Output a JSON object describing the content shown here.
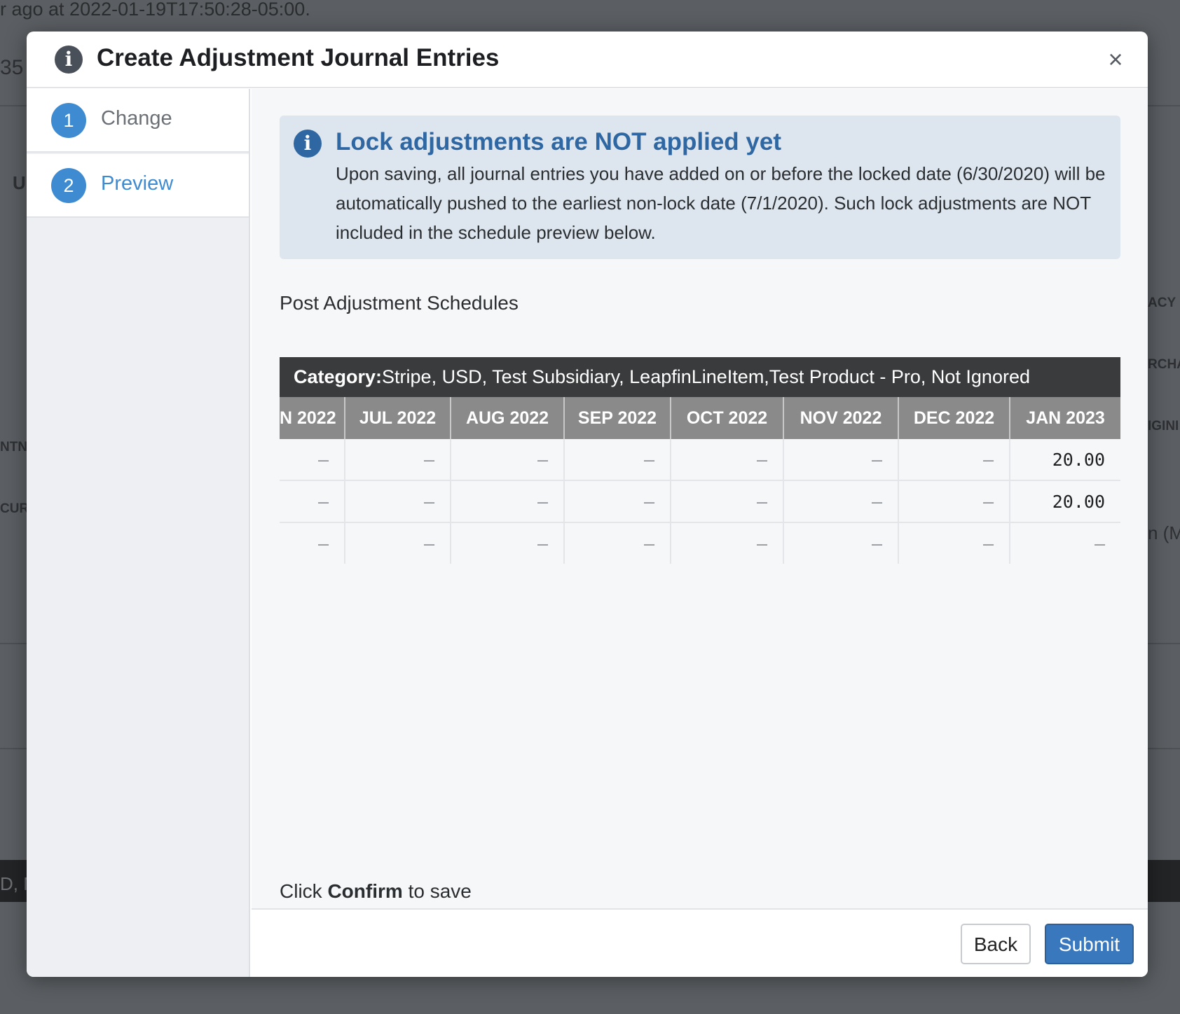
{
  "background": {
    "top_text": "r ago at 2022-01-19T17:50:28-05:00.",
    "number_fragment": "35",
    "left_fragments": [
      "U",
      "NTN",
      "CURR",
      "D, M"
    ],
    "right_fragments": [
      "ACY",
      "RCHA",
      "IGINI",
      "n (M"
    ]
  },
  "modal": {
    "title": "Create Adjustment Journal Entries",
    "info_icon": "i",
    "close_label": "×"
  },
  "steps": [
    {
      "number": "1",
      "label": "Change",
      "active": false
    },
    {
      "number": "2",
      "label": "Preview",
      "active": true
    }
  ],
  "alert": {
    "icon": "i",
    "title": "Lock adjustments are NOT applied yet",
    "body": "Upon saving, all journal entries you have added on or before the locked date (6/30/2020) will be automatically pushed to the earliest non-lock date (7/1/2020). Such lock adjustments are NOT included in the schedule preview below."
  },
  "schedules": {
    "label": "Post Adjustment Schedules",
    "category_prefix": "Category:",
    "category_value": "Stripe, USD, Test Subsidiary, LeapfinLineItem,Test Product - Pro, Not Ignored",
    "columns": [
      "N 2022",
      "JUL 2022",
      "AUG 2022",
      "SEP 2022",
      "OCT 2022",
      "NOV 2022",
      "DEC 2022",
      "JAN 2023"
    ],
    "rows": [
      [
        "–",
        "–",
        "–",
        "–",
        "–",
        "–",
        "–",
        "20.00"
      ],
      [
        "–",
        "–",
        "–",
        "–",
        "–",
        "–",
        "–",
        "20.00"
      ],
      [
        "–",
        "–",
        "–",
        "–",
        "–",
        "–",
        "–",
        "–"
      ]
    ]
  },
  "confirm": {
    "prefix": "Click",
    "keyword": "Confirm",
    "suffix": "to save"
  },
  "footer": {
    "back_label": "Back",
    "submit_label": "Submit"
  }
}
